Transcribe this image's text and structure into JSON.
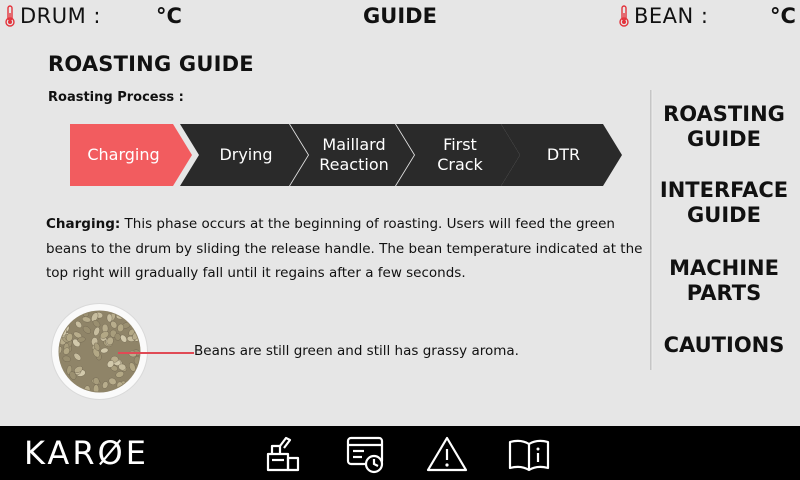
{
  "header": {
    "drum_label": "DRUM :",
    "drum_unit": "°C",
    "title": "GUIDE",
    "bean_label": "BEAN :",
    "bean_unit": "°C"
  },
  "page": {
    "title": "ROASTING GUIDE",
    "process_label": "Roasting Process :"
  },
  "steps": [
    {
      "label": "Charging",
      "active": true
    },
    {
      "label": "Drying",
      "active": false
    },
    {
      "label": "Maillard\nReaction",
      "active": false
    },
    {
      "label": "First\nCrack",
      "active": false
    },
    {
      "label": "DTR",
      "active": false
    }
  ],
  "description": {
    "term": "Charging:",
    "text": " This phase occurs at the beginning of roasting. Users will feed the green beans to the drum by sliding the release handle. The bean temperature indicated at the top right will gradually fall until it regains after a few seconds."
  },
  "image_caption": "Beans are still green and still has grassy aroma.",
  "side_menu": {
    "roasting_guide": "ROASTING\nGUIDE",
    "interface_guide": "INTERFACE\nGUIDE",
    "machine_parts": "MACHINE\nPARTS",
    "cautions": "CAUTIONS"
  },
  "footer": {
    "brand": "KARØE"
  },
  "colors": {
    "active_step": "#f25c5f",
    "inactive_step": "#2a2a2a",
    "background": "#e6e6e6",
    "thermometer": "#e3323b",
    "footer": "#000000"
  },
  "icons": {
    "footer_nav": [
      "roaster-machine-icon",
      "roast-profile-icon",
      "warning-icon",
      "guide-book-icon"
    ],
    "thermometer": "thermometer-icon"
  }
}
